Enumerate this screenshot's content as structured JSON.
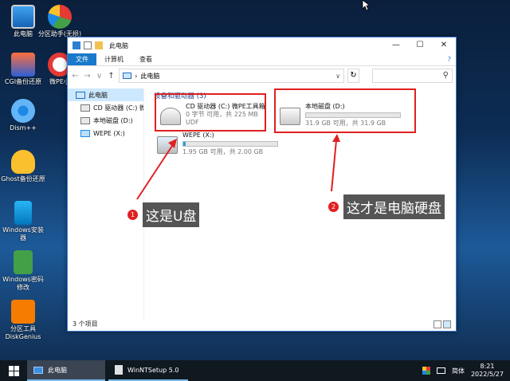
{
  "desktop": {
    "icons": [
      {
        "label": "此电脑"
      },
      {
        "label": "分区助手(无损)"
      },
      {
        "label": "CGI备份还原"
      },
      {
        "label": "微PE小"
      },
      {
        "label": "Dism++"
      },
      {
        "label": "Ghost备份还原"
      },
      {
        "label": "Windows安装器"
      },
      {
        "label": "Windows密码修改"
      },
      {
        "label": "分区工具DiskGenius"
      }
    ]
  },
  "window": {
    "title": "此电脑",
    "controls": {
      "minimize": "—",
      "maximize": "☐",
      "close": "✕"
    },
    "ribbon": {
      "tabs": [
        "文件",
        "计算机",
        "查看"
      ],
      "help": "?"
    },
    "address": {
      "path": "此电脑",
      "back": "←",
      "forward": "→",
      "dropdown": "∨",
      "up": "↑",
      "refresh": "↻",
      "path_dropdown": "∨"
    },
    "sidebar": {
      "items": [
        {
          "label": "此电脑"
        },
        {
          "label": "CD 驱动器 (C:) 微P"
        },
        {
          "label": "本地磁盘 (D:)"
        },
        {
          "label": "WEPE (X:)"
        }
      ]
    },
    "content": {
      "group_header": "设备和驱动器 (3)",
      "drives": [
        {
          "name": "CD 驱动器 (C:) 微PE工具箱",
          "meta1": "0 字节 可用，共 225 MB",
          "meta2": "UDF"
        },
        {
          "name": "本地磁盘 (D:)",
          "meta1": "31.9 GB 可用，共 31.9 GB",
          "used_fraction": 0.0
        },
        {
          "name": "WEPE (X:)",
          "meta1": "1.95 GB 可用，共 2.00 GB",
          "used_fraction": 0.025
        }
      ]
    },
    "status": "3 个项目"
  },
  "annotations": [
    {
      "num": "1",
      "text": "这是U盘"
    },
    {
      "num": "2",
      "text": "这才是电脑硬盘"
    }
  ],
  "taskbar": {
    "items": [
      {
        "label": "此电脑"
      },
      {
        "label": "WinNTSetup 5.0"
      }
    ],
    "ime": "简体",
    "time": "8:21",
    "date": "2022/5/27"
  },
  "colors": {
    "accent": "#1979ca",
    "annotation": "#e02020",
    "bar_fill": "#26a0da"
  }
}
